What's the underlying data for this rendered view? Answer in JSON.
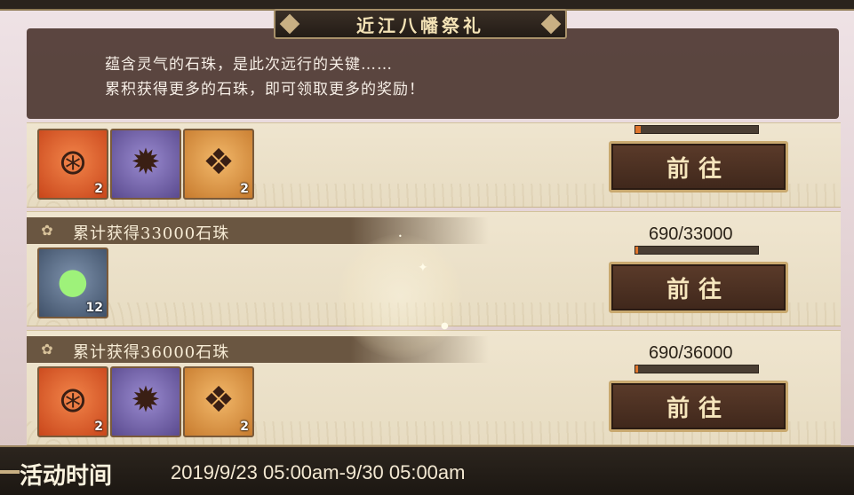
{
  "title": "近江八幡祭礼",
  "description": {
    "line1": "蕴含灵气的石珠，是此次远行的关键……",
    "line2": "累积获得更多的石珠，即可领取更多的奖励！"
  },
  "go_label": "前往",
  "rows": [
    {
      "progress_fraction": 0.04,
      "items": [
        {
          "icon": "talisman-icon",
          "count": "2"
        },
        {
          "icon": "flame-lantern-icon",
          "count": ""
        },
        {
          "icon": "gift-box-icon",
          "count": "2"
        }
      ]
    },
    {
      "title": "累计获得33000石珠",
      "progress": "690/33000",
      "progress_fraction": 0.021,
      "items": [
        {
          "icon": "rainbow-pearl-icon",
          "count": "12"
        }
      ]
    },
    {
      "title": "累计获得36000石珠",
      "progress": "690/36000",
      "progress_fraction": 0.019,
      "items": [
        {
          "icon": "talisman-icon",
          "count": "2"
        },
        {
          "icon": "flame-lantern-icon",
          "count": ""
        },
        {
          "icon": "gift-box-icon",
          "count": "2"
        }
      ]
    }
  ],
  "footer": {
    "label": "活动时间",
    "time": "2019/9/23 05:00am-9/30 05:00am"
  },
  "colors": {
    "progress_fill": "#e0762d",
    "button_border": "#c9a96f",
    "panel_bg": "#4a342e"
  }
}
